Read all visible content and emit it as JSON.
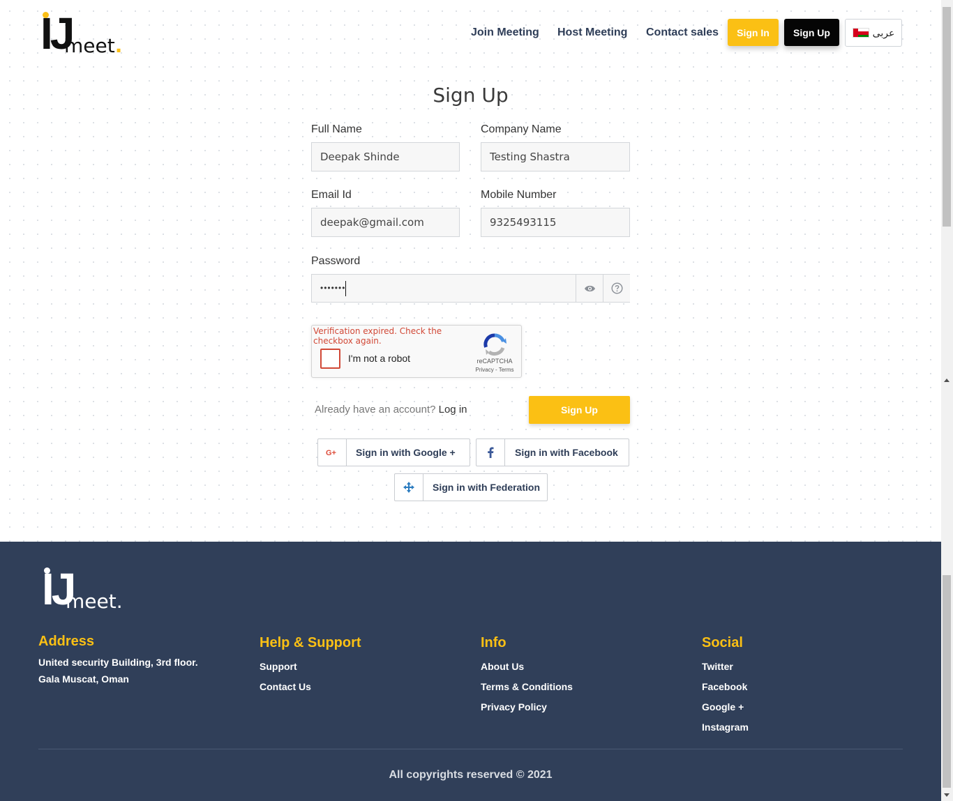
{
  "brand": {
    "logo_mark": "IJ",
    "logo_text": "meet",
    "logo_dot": "."
  },
  "nav": {
    "join_meeting": "Join Meeting",
    "host_meeting": "Host Meeting",
    "contact_sales": "Contact sales",
    "sign_in": "Sign In",
    "sign_up": "Sign Up",
    "language": "عربى"
  },
  "form": {
    "title": "Sign Up",
    "full_name_label": "Full Name",
    "full_name_value": "Deepak Shinde",
    "company_label": "Company Name",
    "company_value": "Testing Shastra",
    "email_label": "Email Id",
    "email_value": "deepak@gmail.com",
    "mobile_label": "Mobile Number",
    "mobile_value": "9325493115",
    "password_label": "Password",
    "password_value": "•••••••",
    "captcha_error": "Verification expired. Check the checkbox again.",
    "captcha_text": "I'm not a robot",
    "captcha_brand": "reCAPTCHA",
    "captcha_privacy": "Privacy",
    "captcha_terms": "Terms",
    "already_text": "Already have an account?",
    "login_link": "Log in",
    "submit": "Sign Up",
    "google": "Sign in with Google +",
    "facebook": "Sign in with Facebook",
    "federation": "Sign in with Federation"
  },
  "footer": {
    "address_heading": "Address",
    "address_line1": "United security Building, 3rd floor.",
    "address_line2": "Gala Muscat, Oman",
    "help_heading": "Help & Support",
    "help_items": [
      "Support",
      "Contact Us"
    ],
    "info_heading": "Info",
    "info_items": [
      "About Us",
      "Terms & Conditions",
      "Privacy Policy"
    ],
    "social_heading": "Social",
    "social_items": [
      "Twitter",
      "Facebook",
      "Google +",
      "Instagram"
    ],
    "copyright": "All copyrights reserved © 2021"
  },
  "colors": {
    "accent": "#fbc014",
    "footer_bg": "#303f59",
    "nav_text": "#2e3d57",
    "error": "#d14836"
  },
  "icons": {
    "password_toggle": "eye-icon",
    "password_help": "help-circle-icon",
    "google": "google-plus-icon",
    "facebook": "facebook-icon",
    "federation": "federation-icon"
  }
}
